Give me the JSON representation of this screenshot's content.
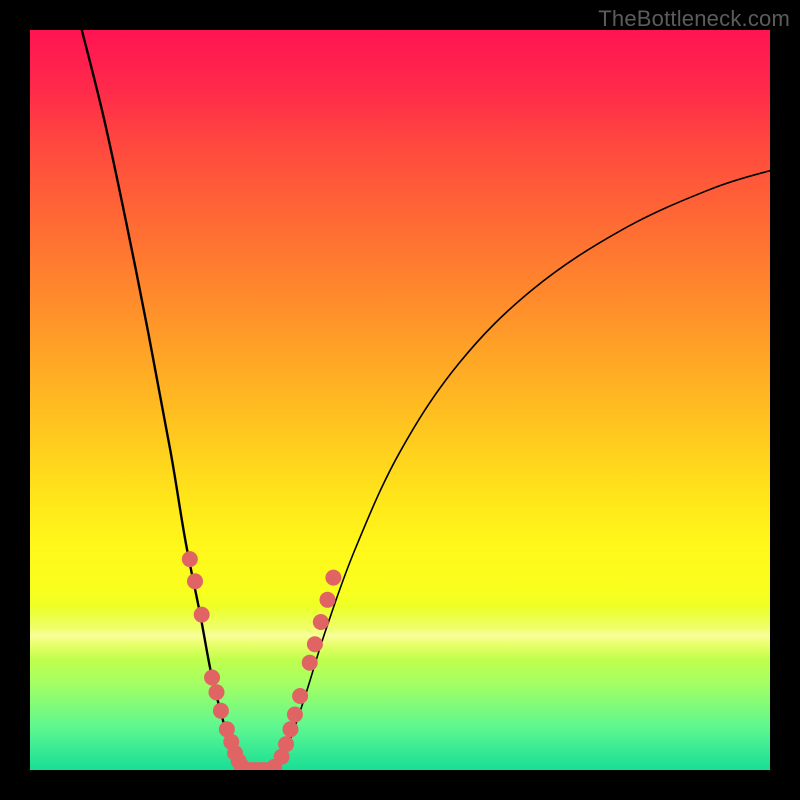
{
  "watermark": "TheBottleneck.com",
  "chart_data": {
    "type": "line",
    "title": "",
    "xlabel": "",
    "ylabel": "",
    "xlim": [
      0,
      100
    ],
    "ylim": [
      0,
      100
    ],
    "grid": false,
    "legend": false,
    "series": [
      {
        "name": "curve-descending",
        "x": [
          7,
          10,
          13,
          16,
          19,
          21,
          23,
          24.5,
          26,
          27,
          27.8,
          28.5,
          29
        ],
        "values": [
          100,
          88,
          74,
          59,
          43,
          31,
          21,
          13,
          7,
          3.5,
          1.5,
          0.5,
          0
        ]
      },
      {
        "name": "curve-ascending",
        "x": [
          33,
          34,
          35.5,
          37.5,
          40,
          44,
          50,
          58,
          68,
          80,
          92,
          100
        ],
        "values": [
          0,
          1.5,
          5,
          11,
          19,
          30,
          43,
          55,
          65,
          73,
          78.5,
          81
        ]
      },
      {
        "name": "flat-bottom",
        "x": [
          29,
          30,
          31,
          32,
          33
        ],
        "values": [
          0,
          0,
          0,
          0,
          0
        ]
      },
      {
        "name": "dots-left",
        "x": [
          21.6,
          22.3,
          23.2,
          24.6,
          25.2,
          25.8,
          26.6,
          27.2,
          27.7,
          28.2
        ],
        "values": [
          28.5,
          25.5,
          21,
          12.5,
          10.5,
          8,
          5.5,
          3.8,
          2.3,
          1.2
        ]
      },
      {
        "name": "dots-right",
        "x": [
          34.0,
          34.6,
          35.2,
          35.8,
          36.5,
          37.8,
          38.5,
          39.3,
          40.2,
          41.0
        ],
        "values": [
          1.8,
          3.5,
          5.5,
          7.5,
          10,
          14.5,
          17,
          20,
          23,
          26
        ]
      },
      {
        "name": "dots-bottom",
        "x": [
          28.6,
          29.3,
          30.0,
          30.8,
          31.6,
          32.4,
          33.0
        ],
        "values": [
          0.5,
          0,
          0,
          0,
          0,
          0,
          0.4
        ]
      }
    ],
    "colors": {
      "curve": "#000000",
      "dot": "#e06464"
    },
    "dot_radius": 8
  }
}
